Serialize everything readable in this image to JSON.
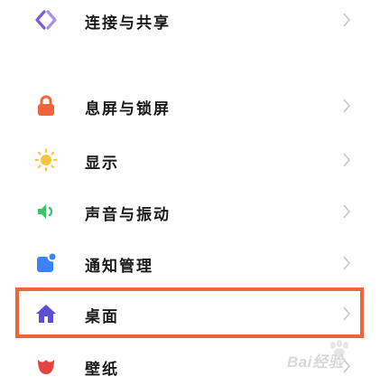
{
  "settings": {
    "items": [
      {
        "label": "连接与共享",
        "icon": "share-diamond-icon",
        "color": "#7b5ed0"
      },
      {
        "label": "息屏与锁屏",
        "icon": "lock-icon",
        "color": "#f0643c"
      },
      {
        "label": "显示",
        "icon": "sun-icon",
        "color": "#f5c542"
      },
      {
        "label": "声音与振动",
        "icon": "speaker-icon",
        "color": "#3ec46d"
      },
      {
        "label": "通知管理",
        "icon": "notification-icon",
        "color": "#3b82f6"
      },
      {
        "label": "桌面",
        "icon": "home-icon",
        "color": "#5b4fd6"
      },
      {
        "label": "壁纸",
        "icon": "wallpaper-icon",
        "color": "#e0463f"
      }
    ],
    "highlighted_index": 5
  },
  "watermark": {
    "text": "Bai经验"
  },
  "colors": {
    "highlight_border": "#f0643c",
    "chevron": "#c8c8c8"
  }
}
